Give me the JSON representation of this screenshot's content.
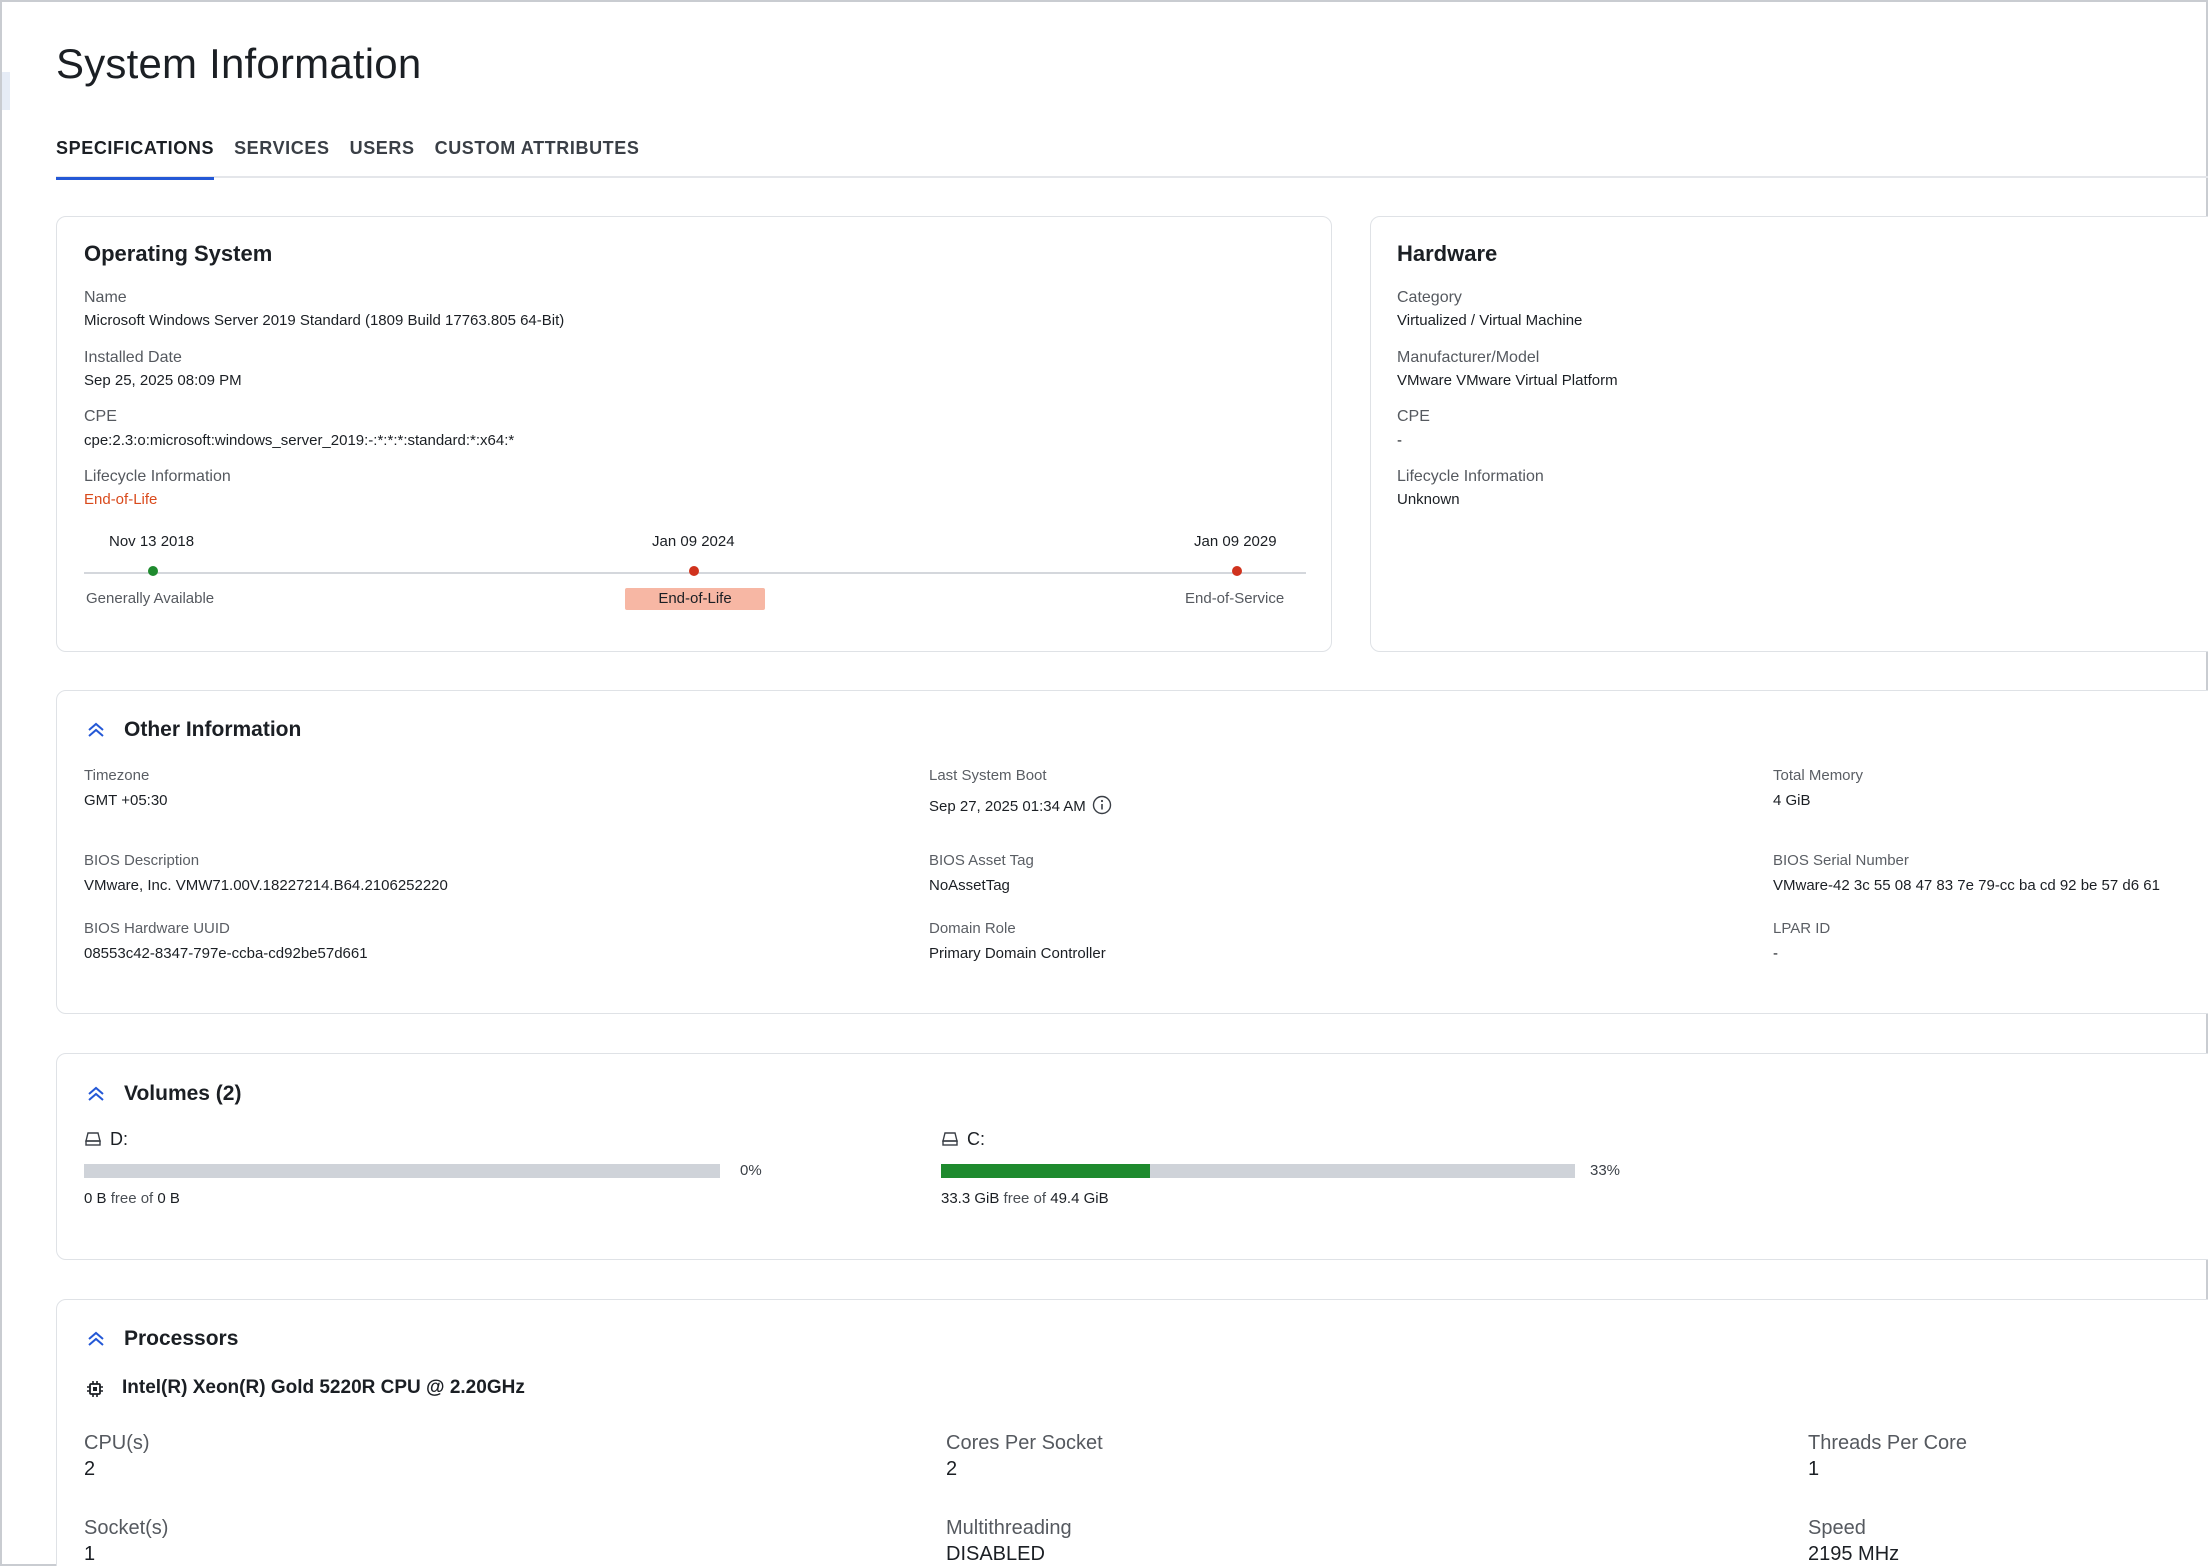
{
  "page": {
    "title": "System Information"
  },
  "tabs": [
    {
      "label": "SPECIFICATIONS",
      "active": true
    },
    {
      "label": "SERVICES",
      "active": false
    },
    {
      "label": "USERS",
      "active": false
    },
    {
      "label": "CUSTOM ATTRIBUTES",
      "active": false
    }
  ],
  "os": {
    "title": "Operating System",
    "name_label": "Name",
    "name_value": "Microsoft Windows Server 2019 Standard (1809 Build 17763.805 64-Bit)",
    "installed_label": "Installed Date",
    "installed_value": "Sep 25, 2025 08:09 PM",
    "cpe_label": "CPE",
    "cpe_value": "cpe:2.3:o:microsoft:windows_server_2019:-:*:*:*:standard:*:x64:*",
    "lifecycle_label": "Lifecycle Information",
    "lifecycle_value": "End-of-Life",
    "timeline": [
      {
        "date": "Nov 13 2018",
        "caption": "Generally Available",
        "color": "#1e8a2e"
      },
      {
        "date": "Jan 09 2024",
        "caption": "End-of-Life",
        "color": "#d0321d"
      },
      {
        "date": "Jan 09 2029",
        "caption": "End-of-Service",
        "color": "#d0321d"
      }
    ]
  },
  "hardware": {
    "title": "Hardware",
    "category_label": "Category",
    "category_value": "Virtualized / Virtual Machine",
    "model_label": "Manufacturer/Model",
    "model_value": "VMware VMware Virtual Platform",
    "cpe_label": "CPE",
    "cpe_value": "-",
    "lifecycle_label": "Lifecycle Information",
    "lifecycle_value": "Unknown"
  },
  "other": {
    "title": "Other Information",
    "timezone_label": "Timezone",
    "timezone_value": "GMT +05:30",
    "boot_label": "Last System Boot",
    "boot_value": "Sep 27, 2025 01:34 AM",
    "memory_label": "Total Memory",
    "memory_value": "4 GiB",
    "bios_desc_label": "BIOS Description",
    "bios_desc_value": "VMware, Inc. VMW71.00V.18227214.B64.2106252220",
    "bios_asset_label": "BIOS Asset Tag",
    "bios_asset_value": "NoAssetTag",
    "bios_serial_label": "BIOS Serial Number",
    "bios_serial_value": "VMware-42 3c 55 08 47 83 7e 79-cc ba cd 92 be 57 d6 61",
    "bios_uuid_label": "BIOS Hardware UUID",
    "bios_uuid_value": "08553c42-8347-797e-ccba-cd92be57d661",
    "domain_role_label": "Domain Role",
    "domain_role_value": "Primary Domain Controller",
    "lpar_label": "LPAR ID",
    "lpar_value": "-"
  },
  "volumes": {
    "title": "Volumes (2)",
    "free_word": "free of",
    "items": [
      {
        "name": "D:",
        "percent_label": "0%",
        "used_fraction": 0.0,
        "free": "0 B",
        "total": "0 B"
      },
      {
        "name": "C:",
        "percent_label": "33%",
        "used_fraction": 0.33,
        "free": "33.3 GiB",
        "total": "49.4 GiB"
      }
    ]
  },
  "processors": {
    "title": "Processors",
    "name": "Intel(R) Xeon(R) Gold 5220R CPU @ 2.20GHz",
    "cpus_label": "CPU(s)",
    "cpus_value": "2",
    "cores_label": "Cores Per Socket",
    "cores_value": "2",
    "threads_label": "Threads Per Core",
    "threads_value": "1",
    "sockets_label": "Socket(s)",
    "sockets_value": "1",
    "mt_label": "Multithreading",
    "mt_value": "DISABLED",
    "speed_label": "Speed",
    "speed_value": "2195 MHz"
  }
}
